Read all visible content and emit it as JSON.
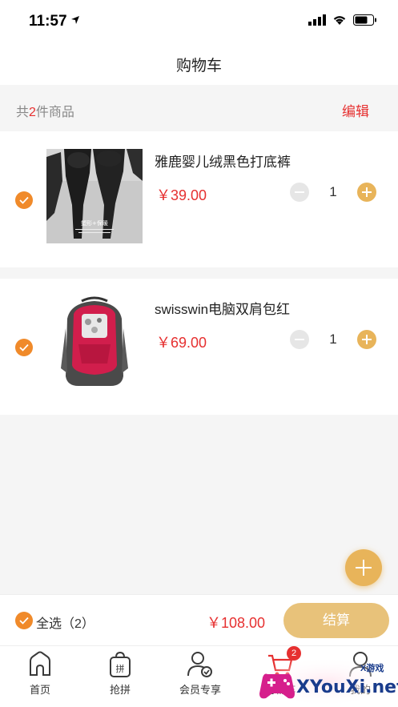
{
  "status_bar": {
    "time": "11:57"
  },
  "nav": {
    "title": "购物车"
  },
  "summary": {
    "prefix": "共",
    "count": "2",
    "suffix": "件商品",
    "edit_label": "编辑"
  },
  "items": [
    {
      "name": "雅鹿婴儿绒黑色打底裤",
      "price": "￥39.00",
      "quantity": "1",
      "checked": true,
      "image": "black-leggings-photo",
      "image_text": "塑形+保暖"
    },
    {
      "name": "swisswin电脑双肩包红",
      "price": "￥69.00",
      "quantity": "1",
      "checked": true,
      "image": "red-backpack-photo"
    }
  ],
  "checkout": {
    "select_all_label": "全选（2）",
    "total": "￥108.00",
    "button_label": "结算"
  },
  "tabs": [
    {
      "label": "首页",
      "icon": "home-icon"
    },
    {
      "label": "抢拼",
      "icon": "group-buy-bag-icon",
      "icon_text": "拼"
    },
    {
      "label": "会员专享",
      "icon": "member-icon"
    },
    {
      "label": "购物车",
      "icon": "cart-icon",
      "badge": "2"
    },
    {
      "label": "我的",
      "icon": "profile-icon"
    }
  ],
  "watermark": {
    "brand": "XYouXi.net",
    "small": "X游戏"
  },
  "colors": {
    "accent": "#e63030",
    "check_orange": "#f08a2a",
    "gold": "#e8b45a",
    "checkout_gold": "#e8c27a"
  }
}
